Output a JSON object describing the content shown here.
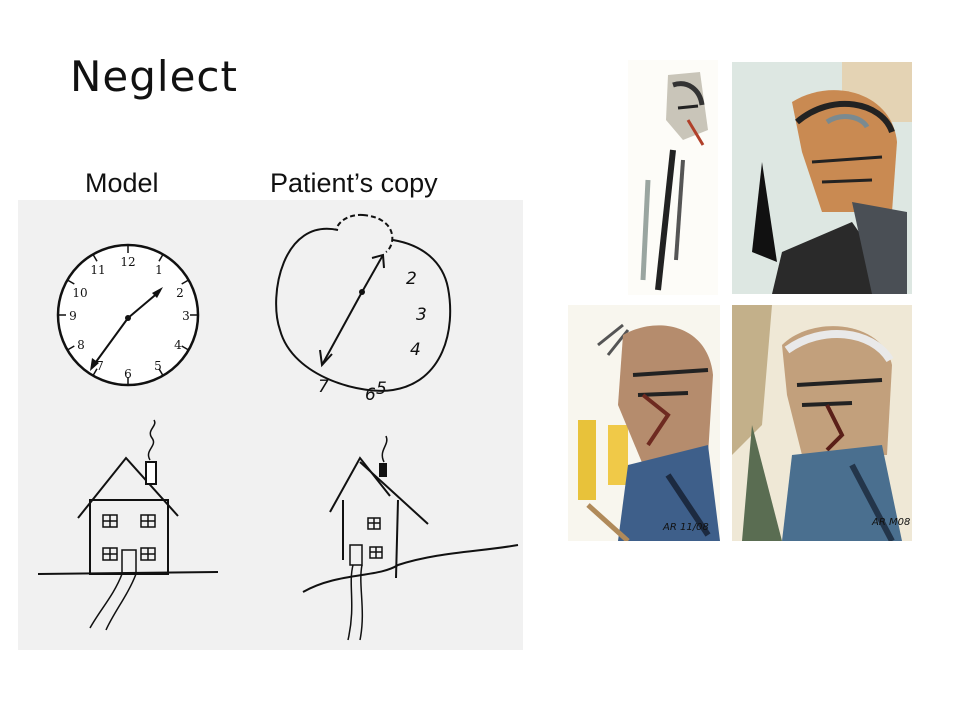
{
  "slide": {
    "title": "Neglect",
    "model_label": "Model",
    "copy_label": "Patient’s copy"
  },
  "model_clock": {
    "numbers": [
      "12",
      "1",
      "2",
      "3",
      "4",
      "5",
      "6",
      "7",
      "8",
      "9",
      "10",
      "11"
    ]
  },
  "patient_clock": {
    "numbers": [
      "2",
      "3",
      "4",
      "6",
      "5",
      "7"
    ]
  },
  "portraits": {
    "signature_3": "AR 11/08",
    "signature_4": "AR M08"
  }
}
